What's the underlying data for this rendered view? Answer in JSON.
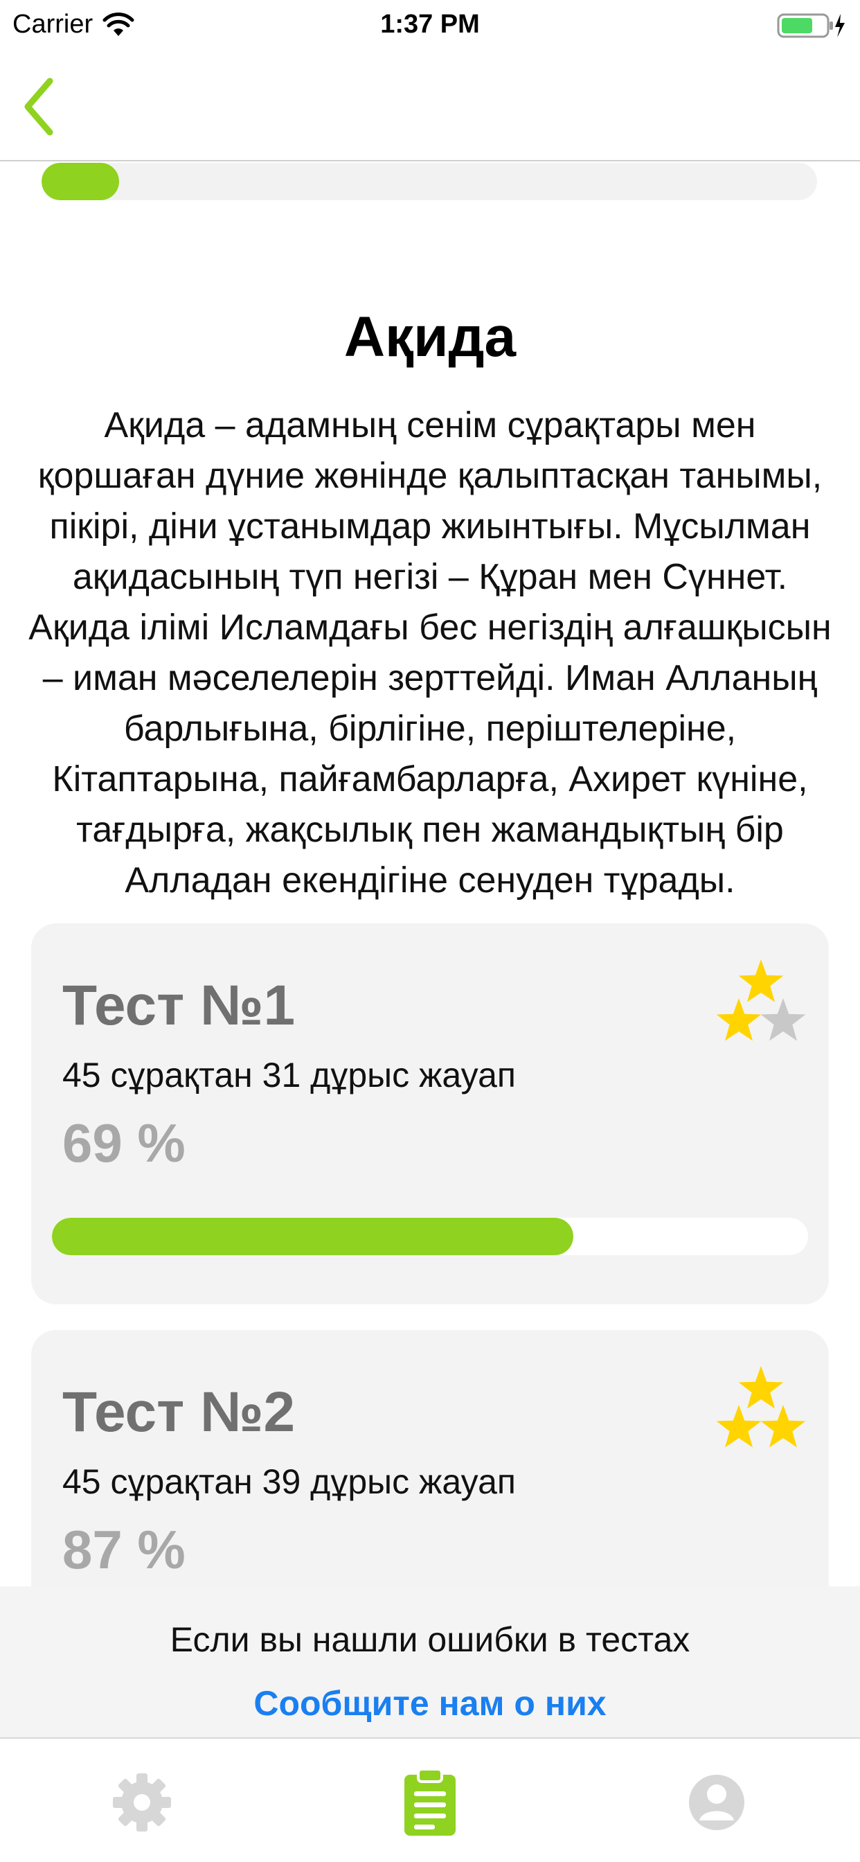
{
  "status_bar": {
    "carrier": "Carrier",
    "time": "1:37 PM",
    "icons": [
      "wifi-icon",
      "battery-charging-icon"
    ]
  },
  "nav": {
    "back_icon": "chevron-left-icon"
  },
  "colors": {
    "accent_green": "#8fd21f",
    "link_blue": "#1a7ff0",
    "star_gold": "#ffd400",
    "star_gray": "#c8c8c8",
    "muted_gray": "#a8a8a8"
  },
  "lesson": {
    "progress": 0.1,
    "title": "Ақида",
    "description": "Ақида – адамның сенім сұрақтары мен қоршаған дүние жөнінде қалыптасқан танымы, пікірі, діни ұстанымдар жиынтығы. Мұсылман ақидасының түп негізі – Құран мен Сүннет. Ақида ілімі Исламдағы бес негіздің алғашқысын – иман мәселелерін  зерттейді. Иман Алланың барлығына, бірлігіне, періштелеріне, Кітаптарына, пайғамбарларға, Ахирет күніне, тағдырға, жақсылық пен жамандықтың бір Алладан екендігіне сенуден тұрады."
  },
  "tests": [
    {
      "title": "Тест №1",
      "subtitle": "45 сұрақтан 31 дұрыс жауап",
      "percent": "69 %",
      "progress": 0.69,
      "stars_filled": 2,
      "stars_total": 3
    },
    {
      "title": "Тест №2",
      "subtitle": "45 сұрақтан 39 дұрыс жауап",
      "percent": "87 %",
      "progress": 0.87,
      "stars_filled": 3,
      "stars_total": 3
    }
  ],
  "report": {
    "text": "Если вы нашли ошибки в тестах",
    "link": "Сообщите нам о них"
  },
  "tabs": [
    {
      "icon": "gear-icon",
      "active": false
    },
    {
      "icon": "clipboard-icon",
      "active": true
    },
    {
      "icon": "user-icon",
      "active": false
    }
  ]
}
